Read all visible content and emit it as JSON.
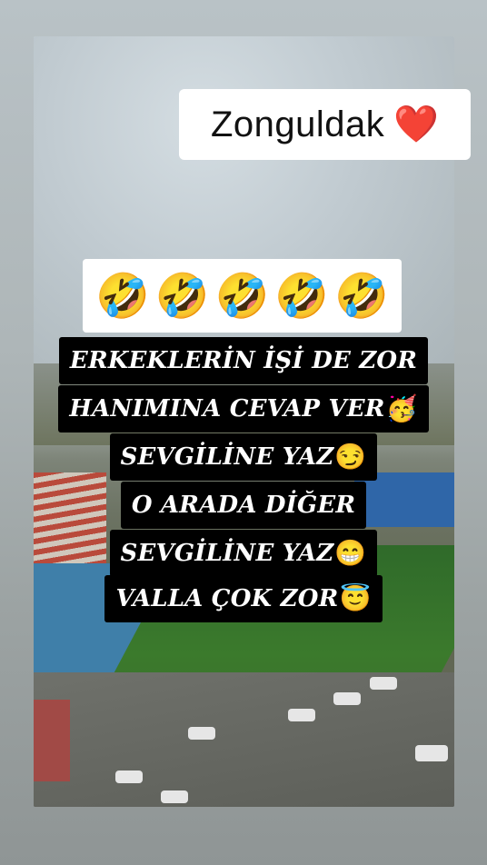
{
  "overlay": {
    "title": "Zonguldak",
    "title_emoji": "❤️",
    "emoji_row": [
      "🤣",
      "🤣",
      "🤣",
      "🤣",
      "🤣"
    ]
  },
  "caption_lines": [
    {
      "text": "ERKEKLERİN İŞİ DE ZOR",
      "emoji": ""
    },
    {
      "text": "HANIMINA CEVAP VER",
      "emoji": "🥳"
    },
    {
      "text": "SEVGİLİNE YAZ",
      "emoji": "😏"
    },
    {
      "text": "O ARADA DİĞER",
      "emoji": ""
    },
    {
      "text": "SEVGİLİNE YAZ",
      "emoji": "😁"
    },
    {
      "text": "VALLA ÇOK ZOR",
      "emoji": "😇"
    }
  ],
  "colors": {
    "caption_bg": "#000000",
    "caption_text": "#ffffff",
    "heart": "#e3162b"
  }
}
